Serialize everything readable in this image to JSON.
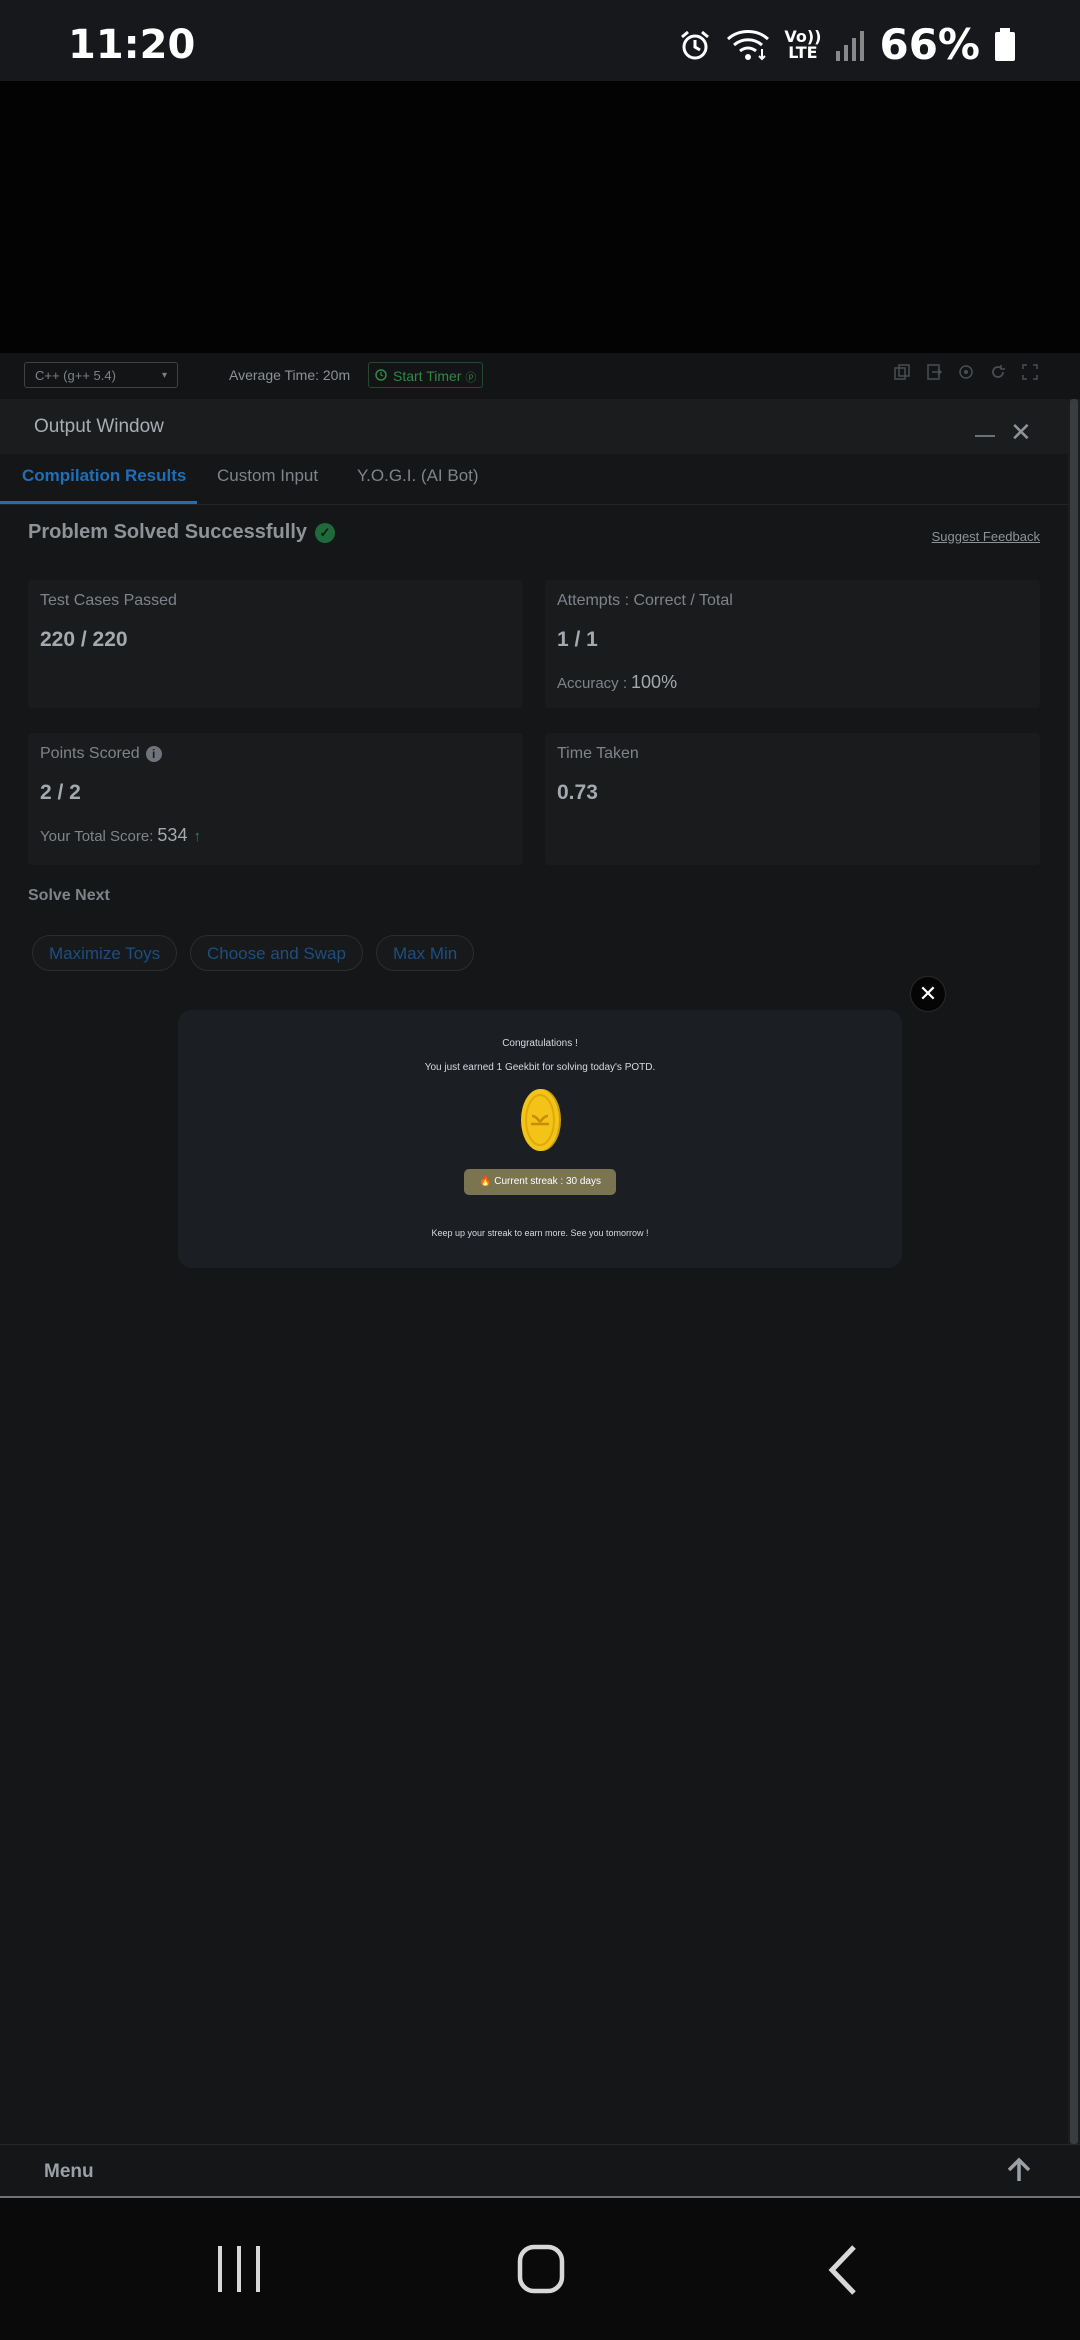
{
  "status_bar": {
    "time": "11:20",
    "volte_top": "Vo))",
    "volte_bottom": "LTE",
    "battery": "66%"
  },
  "editor_toolbar": {
    "language": "C++ (g++ 5.4)",
    "average_time": "Average Time: 20m",
    "start_timer": "Start Timer"
  },
  "output_window": {
    "title": "Output Window",
    "tabs": [
      "Compilation Results",
      "Custom Input",
      "Y.O.G.I. (AI Bot)"
    ],
    "status": "Problem Solved Successfully",
    "suggest_feedback": "Suggest Feedback",
    "cards": {
      "test_cases": {
        "label": "Test Cases Passed",
        "value": "220 / 220"
      },
      "attempts": {
        "label": "Attempts : Correct / Total",
        "value": "1 / 1",
        "accuracy_label": "Accuracy :",
        "accuracy_value": "100%"
      },
      "points": {
        "label": "Points Scored",
        "value": "2 / 2",
        "total_label": "Your Total Score:",
        "total_value": "534"
      },
      "time_taken": {
        "label": "Time Taken",
        "value": "0.73"
      }
    },
    "solve_next": {
      "heading": "Solve Next",
      "items": [
        "Maximize Toys",
        "Choose and Swap",
        "Max Min"
      ]
    }
  },
  "bottom_bar": {
    "menu": "Menu"
  },
  "modal": {
    "title": "Congratulations !",
    "message": "You just earned 1 Geekbit for solving today's POTD.",
    "streak": "Current streak : 30 days",
    "footer": "Keep up your streak to earn more. See you tomorrow !",
    "close_symbol": "✕"
  },
  "colors": {
    "accent_blue": "#1e6fb8",
    "success_green": "#2c8a44",
    "coin_gold": "#f2c418",
    "streak_bg": "#7a7450"
  }
}
